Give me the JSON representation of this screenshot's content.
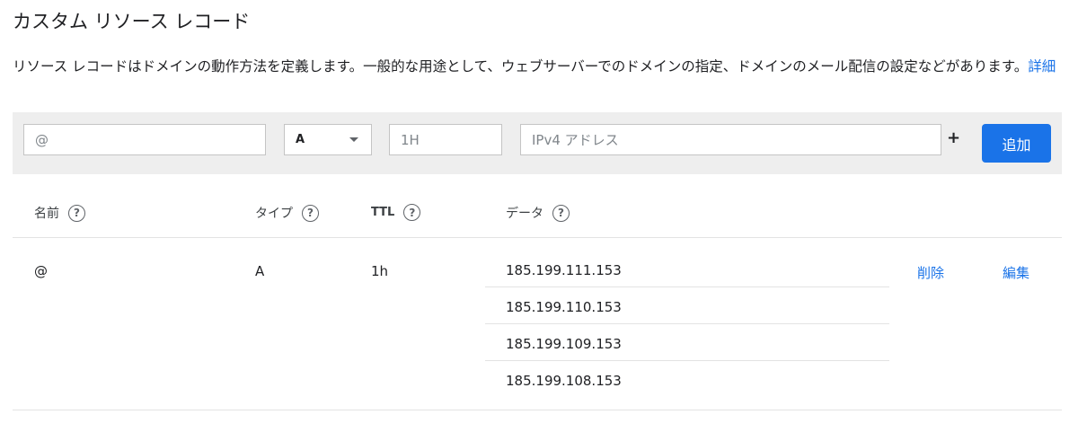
{
  "title": "カスタム リソース レコード",
  "description": {
    "text": "リソース レコードはドメインの動作方法を定義します。一般的な用途として、ウェブサーバーでのドメインの指定、ドメインのメール配信の設定などがあります。",
    "link": "詳細"
  },
  "form": {
    "name_placeholder": "@",
    "type_value": "A",
    "ttl_placeholder": "1H",
    "data_placeholder": "IPv4 アドレス",
    "plus_label": "+",
    "add_label": "追加"
  },
  "table": {
    "headers": {
      "name": "名前",
      "type": "タイプ",
      "ttl": "TTL",
      "data": "データ"
    },
    "help_glyph": "?",
    "record": {
      "name": "@",
      "type": "A",
      "ttl": "1h",
      "data": [
        "185.199.111.153",
        "185.199.110.153",
        "185.199.109.153",
        "185.199.108.153"
      ],
      "delete_label": "削除",
      "edit_label": "編集"
    }
  },
  "colors": {
    "accent": "#1a73e8",
    "form_bar_bg": "#eeeeee"
  }
}
